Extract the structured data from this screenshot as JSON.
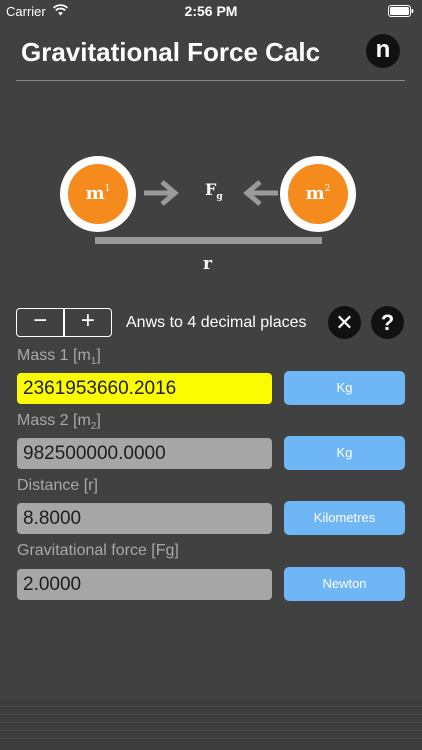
{
  "status_bar": {
    "carrier": "Carrier",
    "time": "2:56 PM"
  },
  "header": {
    "title": "Gravitational Force Calc",
    "n_button_label": "n"
  },
  "diagram": {
    "mass1_letter": "m",
    "mass1_index": "1",
    "mass2_letter": "m",
    "mass2_index": "2",
    "force_letter": "F",
    "force_index": "g",
    "distance_label": "r",
    "mass_color": "#f48b1c",
    "arrow_color": "#9a9a9a"
  },
  "controls": {
    "minus_label": "−",
    "plus_label": "+",
    "decimal_text": "Anws to 4 decimal places",
    "clear_label": "✕",
    "help_label": "?"
  },
  "fields": [
    {
      "label": "Mass 1 [m",
      "label_sub": "1",
      "label_end": "]",
      "value": "2361953660.2016",
      "unit": "Kg",
      "active": true
    },
    {
      "label": "Mass 2 [m",
      "label_sub": "2",
      "label_end": "]",
      "value": "982500000.0000",
      "unit": "Kg",
      "active": false
    },
    {
      "label": "Distance [r]",
      "label_sub": "",
      "label_end": "",
      "value": "8.8000",
      "unit": "Kilometres",
      "active": false
    },
    {
      "label": "Gravitational force [Fg]",
      "label_sub": "",
      "label_end": "",
      "value": "2.0000",
      "unit": "Newton",
      "active": false
    }
  ],
  "colors": {
    "background": "#414141",
    "active_field": "#fcfc01",
    "field": "#a6a6a6",
    "unit_button": "#6fb6f7"
  }
}
